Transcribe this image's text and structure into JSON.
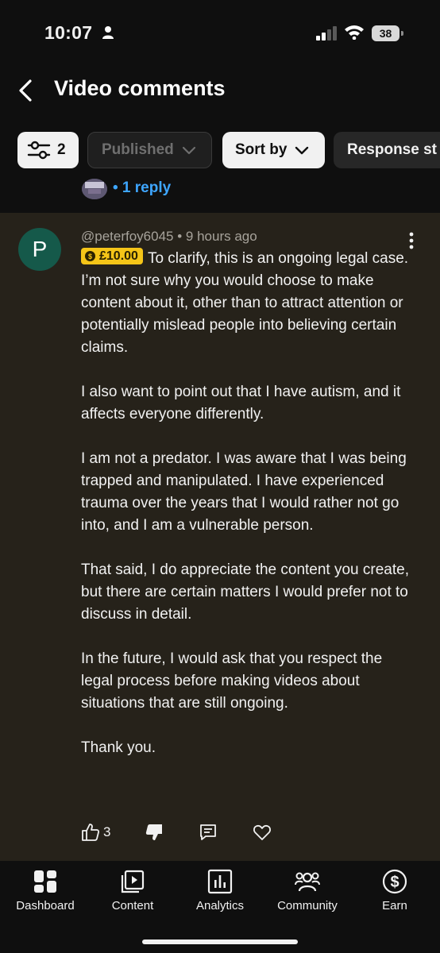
{
  "status_bar": {
    "time": "10:07",
    "battery": "38"
  },
  "header": {
    "title": "Video comments"
  },
  "chips": {
    "filter_count": "2",
    "published": "Published",
    "sort": "Sort by",
    "response": "Response st"
  },
  "prev_reply": {
    "label": "• 1 reply"
  },
  "comment": {
    "avatar_letter": "P",
    "author": "@peterfoy6045",
    "time": "• 9 hours ago",
    "super_thanks": "£10.00",
    "paragraphs": [
      "To clarify, this is an ongoing legal case. I’m not sure why you would choose to make content about it, other than to attract attention or potentially mislead people into believing certain claims.",
      "I also want to point out that I have autism, and it affects everyone differently.",
      "I am not a predator. I was aware that I was being trapped and manipulated. I have experienced trauma over the years that I would rather not go into, and I am a vulnerable person.",
      "That said, I do appreciate the content you create, but there are certain matters I would prefer not to discuss in detail.",
      "In the future, I would ask that you respect the legal process before making videos about situations that are still ongoing.",
      "Thank you."
    ],
    "likes": "3"
  },
  "nav": [
    {
      "label": "Dashboard",
      "icon": "dashboard-icon"
    },
    {
      "label": "Content",
      "icon": "content-icon"
    },
    {
      "label": "Analytics",
      "icon": "analytics-icon"
    },
    {
      "label": "Community",
      "icon": "community-icon"
    },
    {
      "label": "Earn",
      "icon": "earn-icon"
    }
  ],
  "colors": {
    "accent": "#3ea6ff",
    "super_thanks": "#f5c518",
    "avatar": "#15594a",
    "card": "#26221a"
  }
}
